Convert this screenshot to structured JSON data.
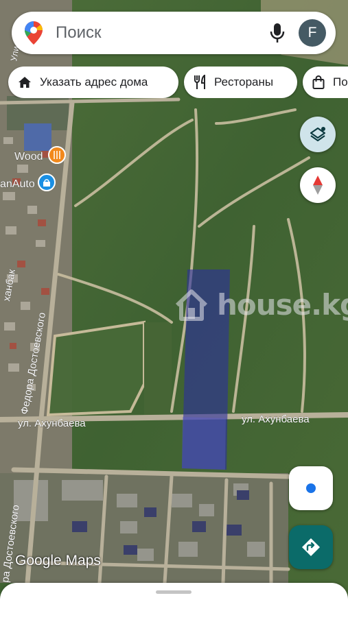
{
  "search": {
    "placeholder": "Поиск",
    "avatar_letter": "F"
  },
  "chips": [
    {
      "label": "Указать адрес дома",
      "icon": "home-icon"
    },
    {
      "label": "Рестораны",
      "icon": "fork-knife-icon"
    },
    {
      "label": "По",
      "icon": "shopping-bag-icon"
    }
  ],
  "map_labels": {
    "street_main_right": "ул. Ахунбаева",
    "street_main_left": "ул. Ахунбаева",
    "street_vertical": "Федора Достоевского",
    "street_vertical_bottom": "ра Достоевского",
    "street_left_edge": "ханбак",
    "street_top": "Ули",
    "poi_wood": "Wood",
    "poi_auto": "anAuto"
  },
  "watermark": "house.kg",
  "attribution": "Google Maps",
  "colors": {
    "parcel": "#2c2f9e",
    "accent_teal": "#0b6b69",
    "location_dot": "#1a73e8"
  }
}
